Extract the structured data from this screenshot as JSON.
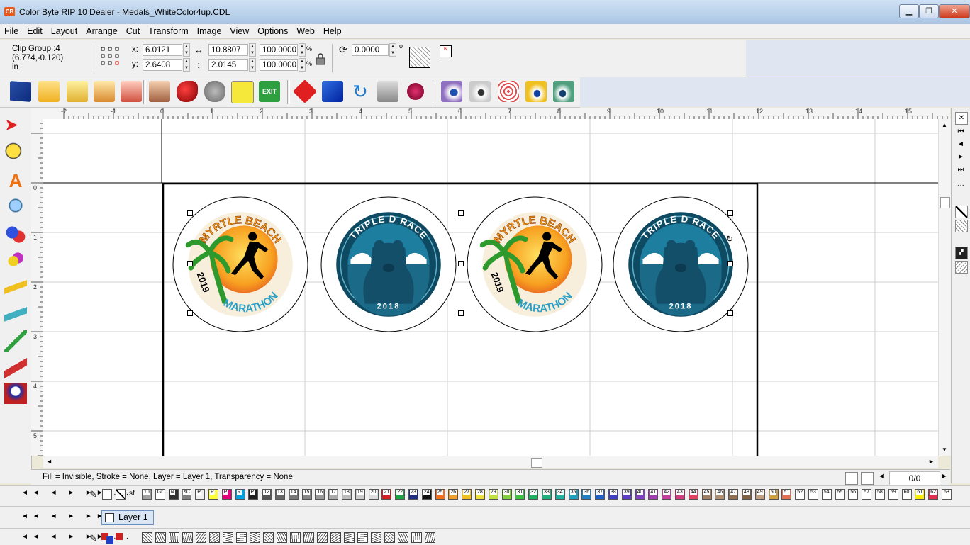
{
  "window": {
    "title": "Color Byte RIP 10 Dealer - Medals_WhiteColor4up.CDL",
    "app_badge": "CB"
  },
  "menu": [
    "File",
    "Edit",
    "Layout",
    "Arrange",
    "Cut",
    "Transform",
    "Image",
    "View",
    "Options",
    "Web",
    "Help"
  ],
  "props": {
    "selection_name": "Clip Group :4",
    "selection_coords": "(6.774,-0.120)",
    "units": "in",
    "x_label": "x:",
    "x_value": "6.0121",
    "y_label": "y:",
    "y_value": "2.6408",
    "w_value": "10.8807",
    "h_value": "2.0145",
    "scale_x": "100.0000",
    "scale_y": "100.0000",
    "pct": "%",
    "rotation": "0.0000",
    "deg": "o",
    "n_box": "N"
  },
  "rulers": {
    "h_labels": [
      "-2",
      "-1",
      "0",
      "1",
      "2",
      "3",
      "4",
      "5",
      "6",
      "7",
      "8",
      "9",
      "10",
      "11",
      "12",
      "13",
      "14",
      "15"
    ],
    "v_labels": [
      "0",
      "1",
      "2",
      "3",
      "4",
      "5"
    ]
  },
  "medals": [
    {
      "kind": "marathon",
      "top_text": "MYRTLE BEACH",
      "bottom_text": "MARATHON",
      "year": "2019"
    },
    {
      "kind": "bear",
      "top_text": "TRIPLE D RACE",
      "year": "2018"
    },
    {
      "kind": "marathon",
      "top_text": "MYRTLE BEACH",
      "bottom_text": "MARATHON",
      "year": "2019"
    },
    {
      "kind": "bear",
      "top_text": "TRIPLE D RACE",
      "year": "2018"
    }
  ],
  "status": {
    "text": "Fill = Invisible, Stroke = None, Layer = Layer 1, Transparency = None",
    "page_counter": "0/0"
  },
  "palette": {
    "nav": "◄◄ ◄ ► ►► ...",
    "swatches": [
      {
        "label": "10",
        "color": "#a0a0a0"
      },
      {
        "label": "Gr",
        "color": "#ffffff"
      },
      {
        "label": "N",
        "color": "#303030"
      },
      {
        "label": "sC",
        "color": "#808080"
      },
      {
        "label": "P",
        "color": "#f0f0f0"
      },
      {
        "label": "P",
        "color": "#ffff33"
      },
      {
        "label": "P",
        "color": "#e0007a"
      },
      {
        "label": "R",
        "color": "#00a0e0"
      },
      {
        "label": "P",
        "color": "#202020"
      },
      {
        "label": "12",
        "color": "#555555"
      },
      {
        "label": "13",
        "color": "#666666"
      },
      {
        "label": "14",
        "color": "#777777"
      },
      {
        "label": "15",
        "color": "#888888"
      },
      {
        "label": "16",
        "color": "#999999"
      },
      {
        "label": "17",
        "color": "#aaaaaa"
      },
      {
        "label": "18",
        "color": "#bbbbbb"
      },
      {
        "label": "19",
        "color": "#cccccc"
      },
      {
        "label": "20",
        "color": "#dddddd"
      },
      {
        "label": "21",
        "color": "#d02020"
      },
      {
        "label": "22",
        "color": "#20a040"
      },
      {
        "label": "23",
        "color": "#203080"
      },
      {
        "label": "24",
        "color": "#101010"
      },
      {
        "label": "25",
        "color": "#f07020"
      },
      {
        "label": "26",
        "color": "#f0a030"
      },
      {
        "label": "27",
        "color": "#f0c020"
      },
      {
        "label": "28",
        "color": "#f0e040"
      },
      {
        "label": "29",
        "color": "#c0e040"
      },
      {
        "label": "30",
        "color": "#80d040"
      },
      {
        "label": "31",
        "color": "#40c040"
      },
      {
        "label": "32",
        "color": "#20b060"
      },
      {
        "label": "33",
        "color": "#20b080"
      },
      {
        "label": "34",
        "color": "#20b0a0"
      },
      {
        "label": "35",
        "color": "#20a0c0"
      },
      {
        "label": "36",
        "color": "#2080c0"
      },
      {
        "label": "37",
        "color": "#2060c0"
      },
      {
        "label": "38",
        "color": "#4040c0"
      },
      {
        "label": "39",
        "color": "#6040c0"
      },
      {
        "label": "40",
        "color": "#8040c0"
      },
      {
        "label": "41",
        "color": "#a040b0"
      },
      {
        "label": "42",
        "color": "#c040a0"
      },
      {
        "label": "43",
        "color": "#d04080"
      },
      {
        "label": "44",
        "color": "#e04060"
      },
      {
        "label": "45",
        "color": "#a08060"
      },
      {
        "label": "46",
        "color": "#b09070"
      },
      {
        "label": "47",
        "color": "#907050"
      },
      {
        "label": "48",
        "color": "#806040"
      },
      {
        "label": "49",
        "color": "#c0a080"
      },
      {
        "label": "50",
        "color": "#d0a040"
      },
      {
        "label": "51",
        "color": "#e07050"
      },
      {
        "label": "52",
        "color": "#ffffff"
      },
      {
        "label": "53",
        "color": "#ffffff"
      },
      {
        "label": "54",
        "color": "#ffffff"
      },
      {
        "label": "55",
        "color": "#ffffff"
      },
      {
        "label": "56",
        "color": "#ffffff"
      },
      {
        "label": "57",
        "color": "#ffffff"
      },
      {
        "label": "58",
        "color": "#ffffff"
      },
      {
        "label": "59",
        "color": "#ffffff"
      },
      {
        "label": "60",
        "color": "#ffffff"
      },
      {
        "label": "61",
        "color": "#ffee00"
      },
      {
        "label": "62",
        "color": "#e03050"
      },
      {
        "label": "63",
        "color": "#ffffff"
      }
    ]
  },
  "layers": {
    "nav": "◄◄ ◄ ► ►► ...",
    "active": "Layer 1"
  },
  "patterns_nav": "◄◄ ◄ ► ►► ..."
}
